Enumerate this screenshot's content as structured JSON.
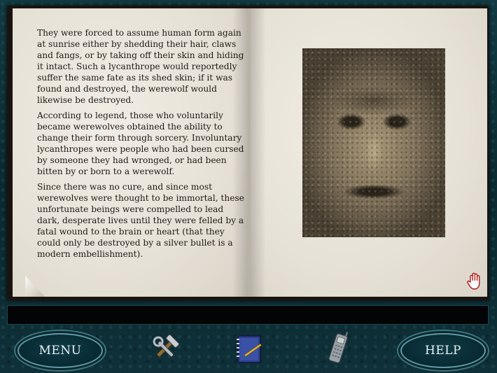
{
  "journal": {
    "paragraphs": [
      "They were forced to assume human form again at sunrise either by shedding their hair, claws and fangs, or by taking off their skin and hiding it intact. Such a lycanthrope would reportedly suffer the same fate as its shed skin; if it was found and destroyed, the werewolf would likewise be destroyed.",
      "According to legend, those who voluntarily became werewolves obtained the ability to change their form through sorcery. Involuntary lycanthropes were people who had been cursed by someone they had wronged, or had been bitten by or born to a werewolf.",
      "Since there was no cure, and since most werewolves were thought to be immortal, these unfortunate beings were compelled to lead dark, desperate lives until they were felled by a fatal wound to the brain or heart (that they could only be destroyed by a silver bullet is a modern embellishment)."
    ]
  },
  "message_bar": {
    "text": ""
  },
  "toolbar": {
    "menu_label": "MENU",
    "help_label": "HELP",
    "icons": [
      "tools-icon",
      "notebook-icon",
      "cellphone-icon"
    ]
  },
  "cursor": {
    "icon": "hand-cursor-icon"
  },
  "colors": {
    "frame": "#0e2a30",
    "page": "#ebe7dd",
    "button_border": "#5f9aa3",
    "text": "#1e1a14"
  }
}
